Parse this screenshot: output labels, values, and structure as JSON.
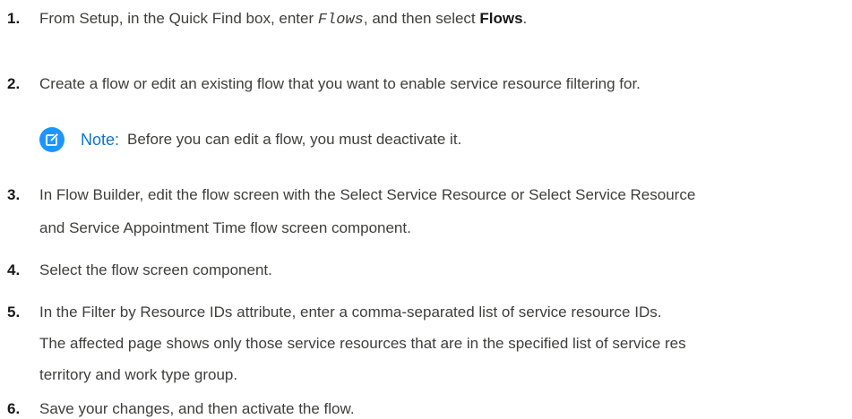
{
  "steps": [
    {
      "number": "1.",
      "text_before": "From Setup, in the Quick Find box, enter ",
      "code": "Flows",
      "text_middle": ", and then select ",
      "bold": "Flows",
      "text_after": "."
    },
    {
      "number": "2.",
      "text": "Create a flow or edit an existing flow that you want to enable service resource filtering for."
    },
    {
      "number": "3.",
      "line1": "In Flow Builder, edit the flow screen with the Select Service Resource or Select Service Resource",
      "line2": "and Service Appointment Time flow screen component."
    },
    {
      "number": "4.",
      "text": "Select the flow screen component."
    },
    {
      "number": "5.",
      "text": "In the Filter by Resource IDs attribute, enter a comma-separated list of service resource IDs.",
      "para_line1": "The affected page shows only those service resources that are in the specified list of service res",
      "para_line2": "territory and work type group."
    },
    {
      "number": "6.",
      "text": "Save your changes, and then activate the flow."
    }
  ],
  "note": {
    "label": "Note:",
    "text": "Before you can edit a flow, you must deactivate it.",
    "icon": "edit-note-icon",
    "accent_color": "#1b96ff"
  }
}
